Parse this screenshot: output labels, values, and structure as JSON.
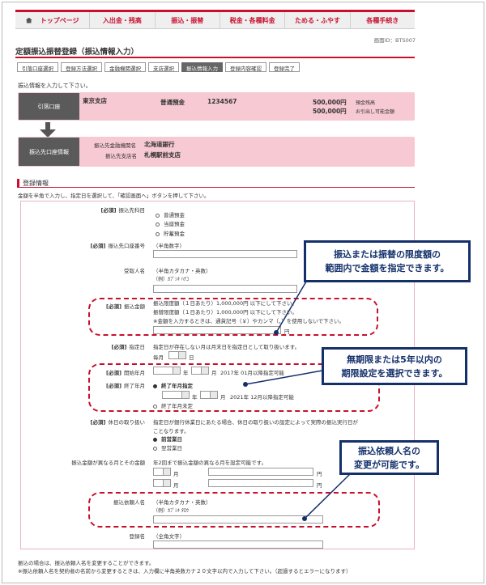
{
  "nav": {
    "items": [
      "トップページ",
      "入出金・残高",
      "振込・振替",
      "税金・各種料金",
      "ためる・ふやす",
      "各種手続き"
    ],
    "screen_id": "画面ID：BTS007"
  },
  "page_title": "定額振込振替登録（振込情報入力）",
  "steps": [
    "引落口座選択",
    "登録方法選択",
    "金融機関選択",
    "支店選択",
    "振込情報入力",
    "登録内容確認",
    "登録完了"
  ],
  "intro": "振込情報を入力して下さい。",
  "debit_account": {
    "label": "引落口座",
    "branch": "東京支店",
    "type": "普通預金",
    "number": "1234567",
    "balance_amount": "500,000円",
    "balance_label": "預金残高",
    "available_amount": "500,000円",
    "available_label": "お引出し可能金額"
  },
  "payee_info": {
    "label": "振込先口座情報",
    "bank_label": "振込先金融機関名",
    "bank_name": "北海道銀行",
    "branch_label": "振込先支店名",
    "branch_name": "札幌駅前支店"
  },
  "registration": {
    "section_title": "登録情報",
    "instruction": "金額を半角で入力し、指定日を選択して、「確認画面へ」ボタンを押して下さい。"
  },
  "form": {
    "required": "[必須]",
    "account_type_label": "振込先科目",
    "account_types": [
      "普通預金",
      "当座預金",
      "貯蓄預金"
    ],
    "account_number_label": "振込先口座番号",
    "account_number_hint": "（半角数字）",
    "recipient_label": "受取人名",
    "recipient_hint": "（半角カタカナ・英数）",
    "recipient_example": "（例）ｶﾌﾞｼｷ ﾊﾅｺ",
    "amount_label": "振込金額",
    "amount_limit1": "振込限度額（１日あたり）1,000,000円 以下にして下さい。",
    "amount_limit2": "振替限度額（１日あたり）1,000,000円 以下にして下さい。",
    "amount_note": "※金額を入力するときは、通貨記号（￥）やカンマ（，）を使用しないで下さい。",
    "yen": "円",
    "date_label": "指定日",
    "date_note": "指定日が存在しない月は月末日を指定日として取り扱います。",
    "monthly": "毎月",
    "day": "日",
    "start_label": "開始年月",
    "year": "年",
    "month": "月",
    "start_note": "2017年 01月以降指定可能",
    "end_label": "終了年月",
    "end_option_specify": "終了年月指定",
    "end_note": "2021年 12月以降指定可能",
    "end_option_none": "終了年月未定",
    "holiday_label": "休日の取り扱い",
    "holiday_note1": "指定日が銀行休業日にあたる場合、休日の取り扱いの設定によって実際の振込実行日が",
    "holiday_note2": "ことなります。",
    "holiday_before": "前営業日",
    "holiday_after": "翌営業日",
    "special_label": "振込金額が異なる月とその金額",
    "special_note": "年2回まで振込金額の異なる月を設定可能です。",
    "requester_label": "振込依頼人名",
    "requester_hint": "（半角カタカナ・英数）",
    "requester_example": "（例）ｶﾌﾞｼｷ ﾀﾛｳ",
    "name_label": "登録名",
    "name_hint": "（全角文字）"
  },
  "footer": {
    "note1": "振込の場合は、振込依頼人名を変更することができます。",
    "note2": "※振込依頼人名を契約者の名前から変更するときは、入力欄に半角英数カナ２０文字以内で入力して下さい。（超過するとエラーになります）"
  },
  "callouts": {
    "amount": "振込または振替の限度額の\n範囲内で金額を指定できます。",
    "period": "無期限または5年以内の\n期限設定を選択できます。",
    "requester": "振込依頼人名の\n変更が可能です。"
  }
}
